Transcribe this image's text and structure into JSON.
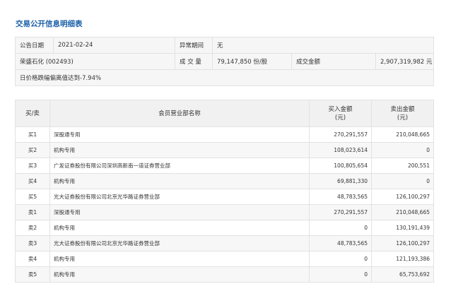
{
  "title": "交易公开信息明细表",
  "summary": {
    "date_label": "公告日期",
    "date_value": "2021-02-24",
    "period_label": "异常期间",
    "period_value": "无",
    "stock_name": "荣盛石化 (002493)",
    "volume_label": "成 交 量",
    "volume_value": "79,147,850 份/股",
    "amount_label": "成交金额",
    "amount_value": "2,907,319,982 元",
    "reason": "日价格跌幅偏离值达到-7.94%"
  },
  "detail": {
    "headers": {
      "side": "买/卖",
      "branch": "会员营业部名称",
      "buy_line1": "买入金额",
      "buy_line2": "(元)",
      "sell_line1": "卖出金额",
      "sell_line2": "(元)"
    },
    "rows": [
      {
        "side": "买1",
        "branch": "深股通专用",
        "buy": "270,291,557",
        "sell": "210,048,665"
      },
      {
        "side": "买2",
        "branch": "机构专用",
        "buy": "108,023,614",
        "sell": "0"
      },
      {
        "side": "买3",
        "branch": "广发证券股份有限公司深圳高新南一道证券营业部",
        "buy": "100,805,654",
        "sell": "200,551"
      },
      {
        "side": "买4",
        "branch": "机构专用",
        "buy": "69,881,330",
        "sell": "0"
      },
      {
        "side": "买5",
        "branch": "光大证券股份有限公司北京光华路证券营业部",
        "buy": "48,783,565",
        "sell": "126,100,297"
      },
      {
        "side": "卖1",
        "branch": "深股通专用",
        "buy": "270,291,557",
        "sell": "210,048,665"
      },
      {
        "side": "卖2",
        "branch": "机构专用",
        "buy": "0",
        "sell": "130,191,439"
      },
      {
        "side": "卖3",
        "branch": "光大证券股份有限公司北京光华路证券营业部",
        "buy": "48,783,565",
        "sell": "126,100,297"
      },
      {
        "side": "卖4",
        "branch": "机构专用",
        "buy": "0",
        "sell": "121,193,386"
      },
      {
        "side": "卖5",
        "branch": "机构专用",
        "buy": "0",
        "sell": "65,753,692"
      }
    ]
  }
}
